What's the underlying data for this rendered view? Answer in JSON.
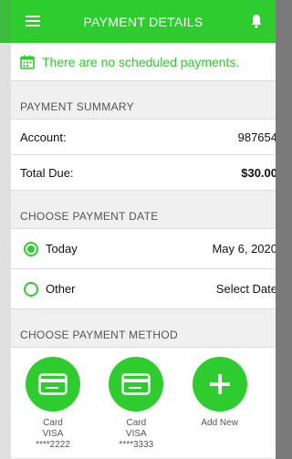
{
  "header": {
    "title": "PAYMENT DETAILS"
  },
  "notice": {
    "text": "There are no scheduled payments."
  },
  "summary": {
    "heading": "PAYMENT SUMMARY",
    "account_label": "Account:",
    "account_value": "987654",
    "total_label": "Total Due:",
    "total_value": "$30.00"
  },
  "date": {
    "heading": "CHOOSE PAYMENT DATE",
    "options": [
      {
        "label": "Today",
        "value": "May 6, 2020",
        "selected": true
      },
      {
        "label": "Other",
        "value": "Select Date",
        "selected": false
      }
    ]
  },
  "method": {
    "heading": "CHOOSE PAYMENT METHOD",
    "cards": [
      {
        "type": "Card",
        "brand": "VISA",
        "number": "****2222"
      },
      {
        "type": "Card",
        "brand": "VISA",
        "number": "****3333"
      }
    ],
    "add_new": "Add New"
  },
  "colors": {
    "accent": "#2ecc2e"
  },
  "icons": [
    "menu-icon",
    "bell-icon",
    "calendar-icon",
    "radio-icon",
    "credit-card-icon",
    "plus-icon"
  ]
}
